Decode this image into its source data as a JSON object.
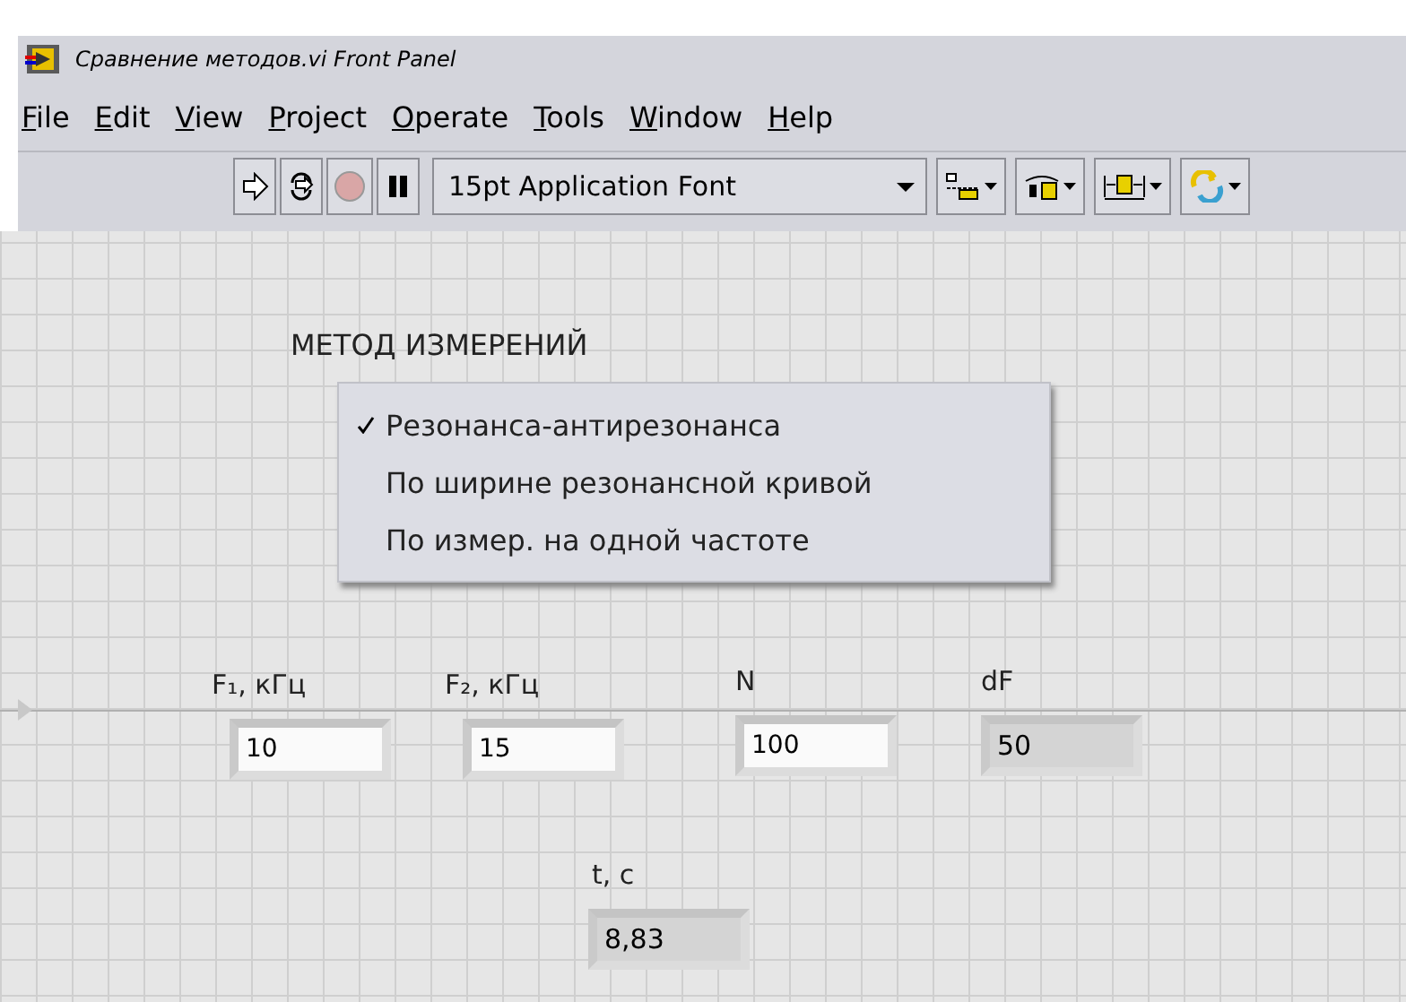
{
  "window": {
    "title": "Сравнение методов.vi Front Panel"
  },
  "menu": [
    "File",
    "Edit",
    "View",
    "Project",
    "Operate",
    "Tools",
    "Window",
    "Help"
  ],
  "toolbar": {
    "run_buttons": [
      {
        "kind": "run"
      },
      {
        "kind": "run-continuous"
      },
      {
        "kind": "abort"
      },
      {
        "kind": "pause"
      }
    ],
    "font": "15pt Application Font",
    "layout_buttons": [
      {
        "kind": "align"
      },
      {
        "kind": "distribute"
      },
      {
        "kind": "resize"
      },
      {
        "kind": "reorder"
      }
    ]
  },
  "ring": {
    "label": "МЕТОД ИЗМЕРЕНИЙ",
    "items": [
      {
        "label": "Резонанса-антирезонанса",
        "selected": true
      },
      {
        "label": "По ширине резонансной кривой",
        "selected": false
      },
      {
        "label": "По измер. на одной частоте",
        "selected": false
      }
    ]
  },
  "numerics": [
    {
      "label": "F₁, кГц",
      "value": "10",
      "kind": "control"
    },
    {
      "label": "F₂, кГц",
      "value": "15",
      "kind": "control"
    },
    {
      "label": "N",
      "value": "100",
      "kind": "control"
    },
    {
      "label": "dF",
      "value": "50",
      "kind": "indicator"
    },
    {
      "label": "t, c",
      "value": "8,83",
      "kind": "indicator"
    }
  ]
}
